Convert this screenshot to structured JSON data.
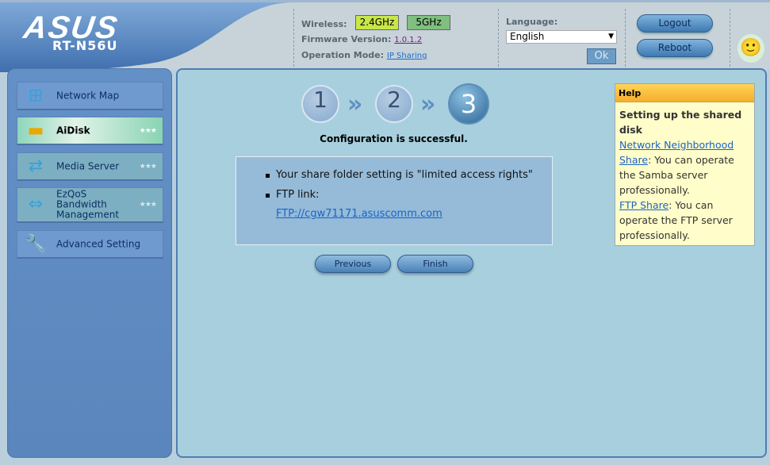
{
  "header": {
    "brand": "ASUS",
    "model": "RT-N56U",
    "wireless_label": "Wireless:",
    "band_24": "2.4GHz",
    "band_5": "5GHz",
    "firmware_label": "Firmware Version:",
    "firmware_value": "1.0.1.2",
    "opmode_label": "Operation Mode:",
    "opmode_value": "IP Sharing",
    "language_label": "Language:",
    "language_value": "English",
    "ok_label": "Ok",
    "logout_label": "Logout",
    "reboot_label": "Reboot"
  },
  "sidebar": {
    "items": [
      {
        "label": "Network Map",
        "icon": "network-map-icon"
      },
      {
        "label": "AiDisk",
        "icon": "aidisk-icon",
        "stars": "★★★",
        "active": true
      },
      {
        "label": "Media Server",
        "icon": "media-server-icon",
        "stars": "★★★"
      },
      {
        "label": "EzQoS Bandwidth Management",
        "icon": "ezqos-icon",
        "stars": "★★★"
      },
      {
        "label": "Advanced Setting",
        "icon": "wrench-screwdriver-icon"
      }
    ]
  },
  "wizard": {
    "steps": [
      "1",
      "2",
      "3"
    ],
    "current_step": 3,
    "status": "Configuration is successful.",
    "bullet1": "Your share folder setting is \"limited access rights\"",
    "bullet2": "FTP link:",
    "ftp_link": "FTP://cgw71171.asuscomm.com",
    "previous_label": "Previous",
    "finish_label": "Finish"
  },
  "help": {
    "title": "Help",
    "heading": "Setting up the shared disk",
    "link1": "Network Neighborhood Share",
    "text1": ": You can operate the Samba server professionally.",
    "link2": "FTP Share",
    "text2": ": You can operate the FTP server professionally."
  },
  "colors": {
    "band_24_bg": "#c8e64a",
    "band_5_bg": "#7fbf7f",
    "main_bg": "#a8cfdd",
    "help_header": "#f6ad2e"
  }
}
